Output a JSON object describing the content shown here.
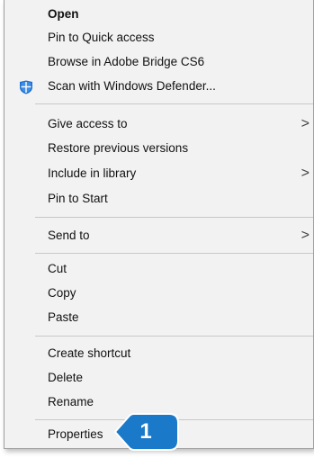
{
  "menu": {
    "items": [
      {
        "label": "Open"
      },
      {
        "label": "Pin to Quick access"
      },
      {
        "label": "Browse in Adobe Bridge CS6"
      },
      {
        "label": "Scan with Windows Defender...",
        "icon": "windows-defender-icon"
      },
      {
        "label": "Give access to",
        "submenu": true
      },
      {
        "label": "Restore previous versions"
      },
      {
        "label": "Include in library",
        "submenu": true
      },
      {
        "label": "Pin to Start"
      },
      {
        "label": "Send to",
        "submenu": true
      },
      {
        "label": "Cut"
      },
      {
        "label": "Copy"
      },
      {
        "label": "Paste"
      },
      {
        "label": "Create shortcut"
      },
      {
        "label": "Delete"
      },
      {
        "label": "Rename"
      },
      {
        "label": "Properties"
      }
    ],
    "submenu_glyph": ">"
  },
  "callout": {
    "number": "1",
    "color": "#1a7ac9"
  },
  "colors": {
    "menu_bg": "#f2f2f2",
    "defender_blue": "#1f6fd0"
  }
}
